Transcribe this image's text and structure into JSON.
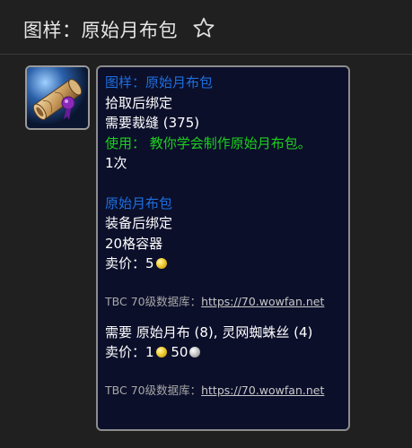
{
  "header": {
    "title": "图样：原始月布包",
    "favorite_icon": "star-outline-icon"
  },
  "item": {
    "icon": "scroll-pattern-icon"
  },
  "tooltip": {
    "name": "图样：原始月布包",
    "binding": "拾取后绑定",
    "requirement": "需要裁缝 (375)",
    "use_text": "使用： 教你学会制作原始月布包。",
    "charges": "1次",
    "created_item": {
      "name": "原始月布包",
      "binding": "装备后绑定",
      "container": "20格容器",
      "sell_label": "卖价：",
      "sell_gold": "5"
    },
    "source1": {
      "prefix": "TBC 70级数据库：",
      "link": "https://70.wowfan.net"
    },
    "reagents": "需要 原始月布 (8), 灵网蜘蛛丝 (4)",
    "sell_label": "卖价：",
    "sell_gold": "1",
    "sell_silver": "50",
    "source2": {
      "prefix": "TBC 70级数据库：",
      "link": "https://70.wowfan.net"
    }
  },
  "colors": {
    "tooltip_bg": "#0b0f2a",
    "item_name_blue": "#1e6fe0",
    "use_green": "#1ed01e",
    "header_bg": "#202020"
  }
}
